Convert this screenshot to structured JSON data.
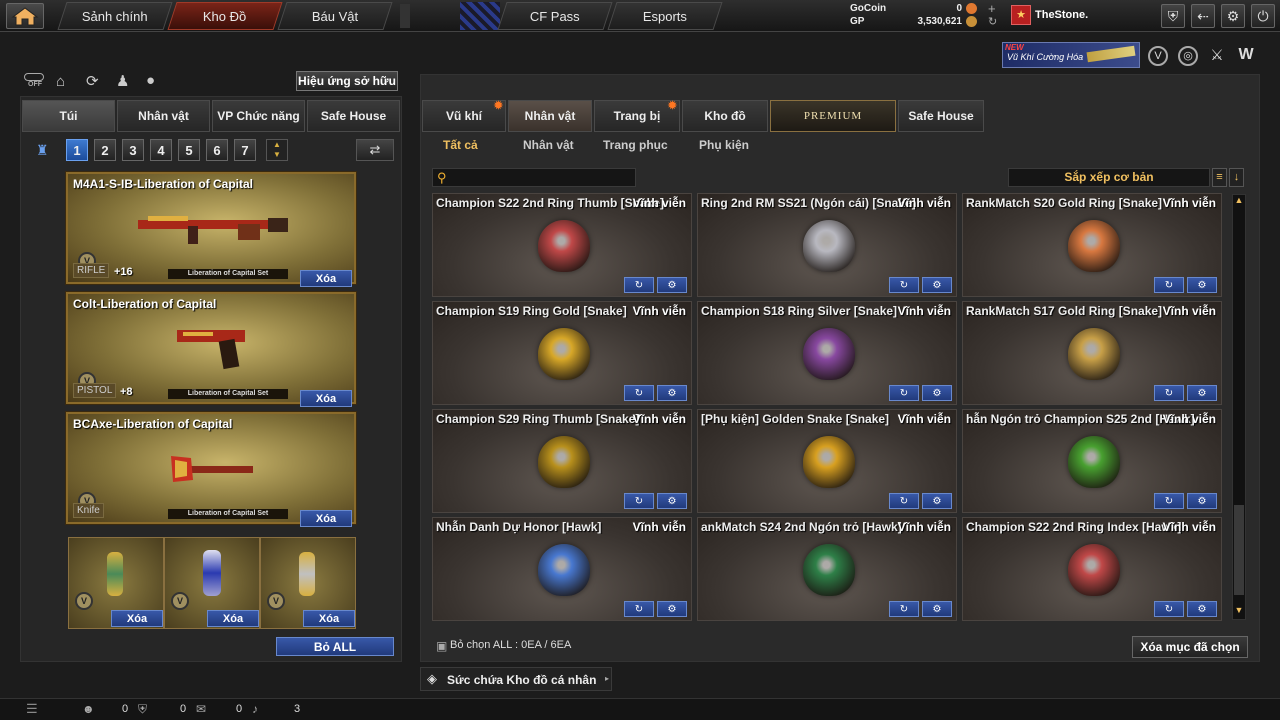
{
  "top": {
    "nav": [
      "Sảnh chính",
      "Kho Đồ",
      "Báu Vật",
      "CF Pass",
      "Esports"
    ],
    "gocoin_label": "GoCoin",
    "gp_label": "GP",
    "gocoin_value": "0",
    "gp_value": "3,530,621",
    "username": "TheStone.",
    "promo_new": "NEW",
    "promo_text": "Vũ Khí Cường Hóa"
  },
  "left": {
    "off_label": "OFF",
    "effect_button": "Hiệu ứng sở hữu",
    "tabs": [
      "Túi",
      "Nhân vật",
      "VP Chức năng",
      "Safe House"
    ],
    "slots": [
      "1",
      "2",
      "3",
      "4",
      "5",
      "6",
      "7"
    ],
    "weapons": [
      {
        "name": "M4A1-S-IB-Liberation of Capital",
        "type": "RIFLE",
        "plus": "+16",
        "set": "Liberation of Capital Set",
        "action": "Xóa"
      },
      {
        "name": "Colt-Liberation of Capital",
        "type": "PISTOL",
        "plus": "+8",
        "set": "Liberation of Capital Set",
        "action": "Xóa"
      },
      {
        "name": "BCAxe-Liberation of Capital",
        "type": "Knife",
        "plus": "",
        "set": "Liberation of Capital Set",
        "action": "Xóa"
      }
    ],
    "grenade_actions": [
      "Xóa",
      "Xóa",
      "Xóa"
    ],
    "remove_all": "Bỏ ALL"
  },
  "right": {
    "tabs": [
      "Vũ khí",
      "Nhân vật",
      "Trang bị",
      "Kho đồ",
      "PREMIUM",
      "Safe House"
    ],
    "subtabs": [
      "Tất cả",
      "Nhân vật",
      "Trang phục",
      "Phụ kiện"
    ],
    "search_placeholder": "",
    "sort_label": "Sắp xếp cơ bản",
    "items": [
      {
        "name": "Champion S22 2nd Ring Thumb [Snake]",
        "perm": "Vĩnh viễn",
        "color": "#c04848"
      },
      {
        "name": "Ring 2nd RM SS21 (Ngón cái) [Snake]",
        "perm": "Vĩnh viễn",
        "color": "#b8b8c0"
      },
      {
        "name": "RankMatch S20 Gold Ring [Snake]",
        "perm": "Vĩnh viễn",
        "color": "#d87840"
      },
      {
        "name": "Champion S19 Ring Gold [Snake]",
        "perm": "Vĩnh viễn",
        "color": "#d8a828"
      },
      {
        "name": "Champion S18 Ring Silver [Snake]",
        "perm": "Vĩnh viễn",
        "color": "#8848a0"
      },
      {
        "name": "RankMatch S17 Gold Ring [Snake]",
        "perm": "Vĩnh viễn",
        "color": "#c8a048"
      },
      {
        "name": "Champion S29 Ring Thumb [Snake]",
        "perm": "Vĩnh viễn",
        "color": "#b8901c"
      },
      {
        "name": "[Phụ kiện] Golden Snake [Snake]",
        "perm": "Vĩnh viễn",
        "color": "#d8a020"
      },
      {
        "name": "hẫn Ngón trỏ Champion S25 2nd [Hawk]",
        "perm": "Vĩnh viễn",
        "color": "#48a030"
      },
      {
        "name": "Nhẫn Danh Dự Honor [Hawk]",
        "perm": "Vĩnh viễn",
        "color": "#4878d0"
      },
      {
        "name": "ankMatch S24 2nd Ngón trỏ [Hawk]",
        "perm": "Vĩnh viễn",
        "color": "#2e8048"
      },
      {
        "name": "Champion S22 2nd Ring Index [Hawk]",
        "perm": "Vĩnh viễn",
        "color": "#c04848"
      }
    ],
    "select_all": "Bỏ chọn ALL : 0EA / 6EA",
    "delete_selected": "Xóa mục đã chọn",
    "capacity": "Sức chứa Kho đồ cá nhân"
  },
  "status": {
    "friends": "0",
    "clan": "0",
    "chat": "0",
    "volume": "3"
  }
}
